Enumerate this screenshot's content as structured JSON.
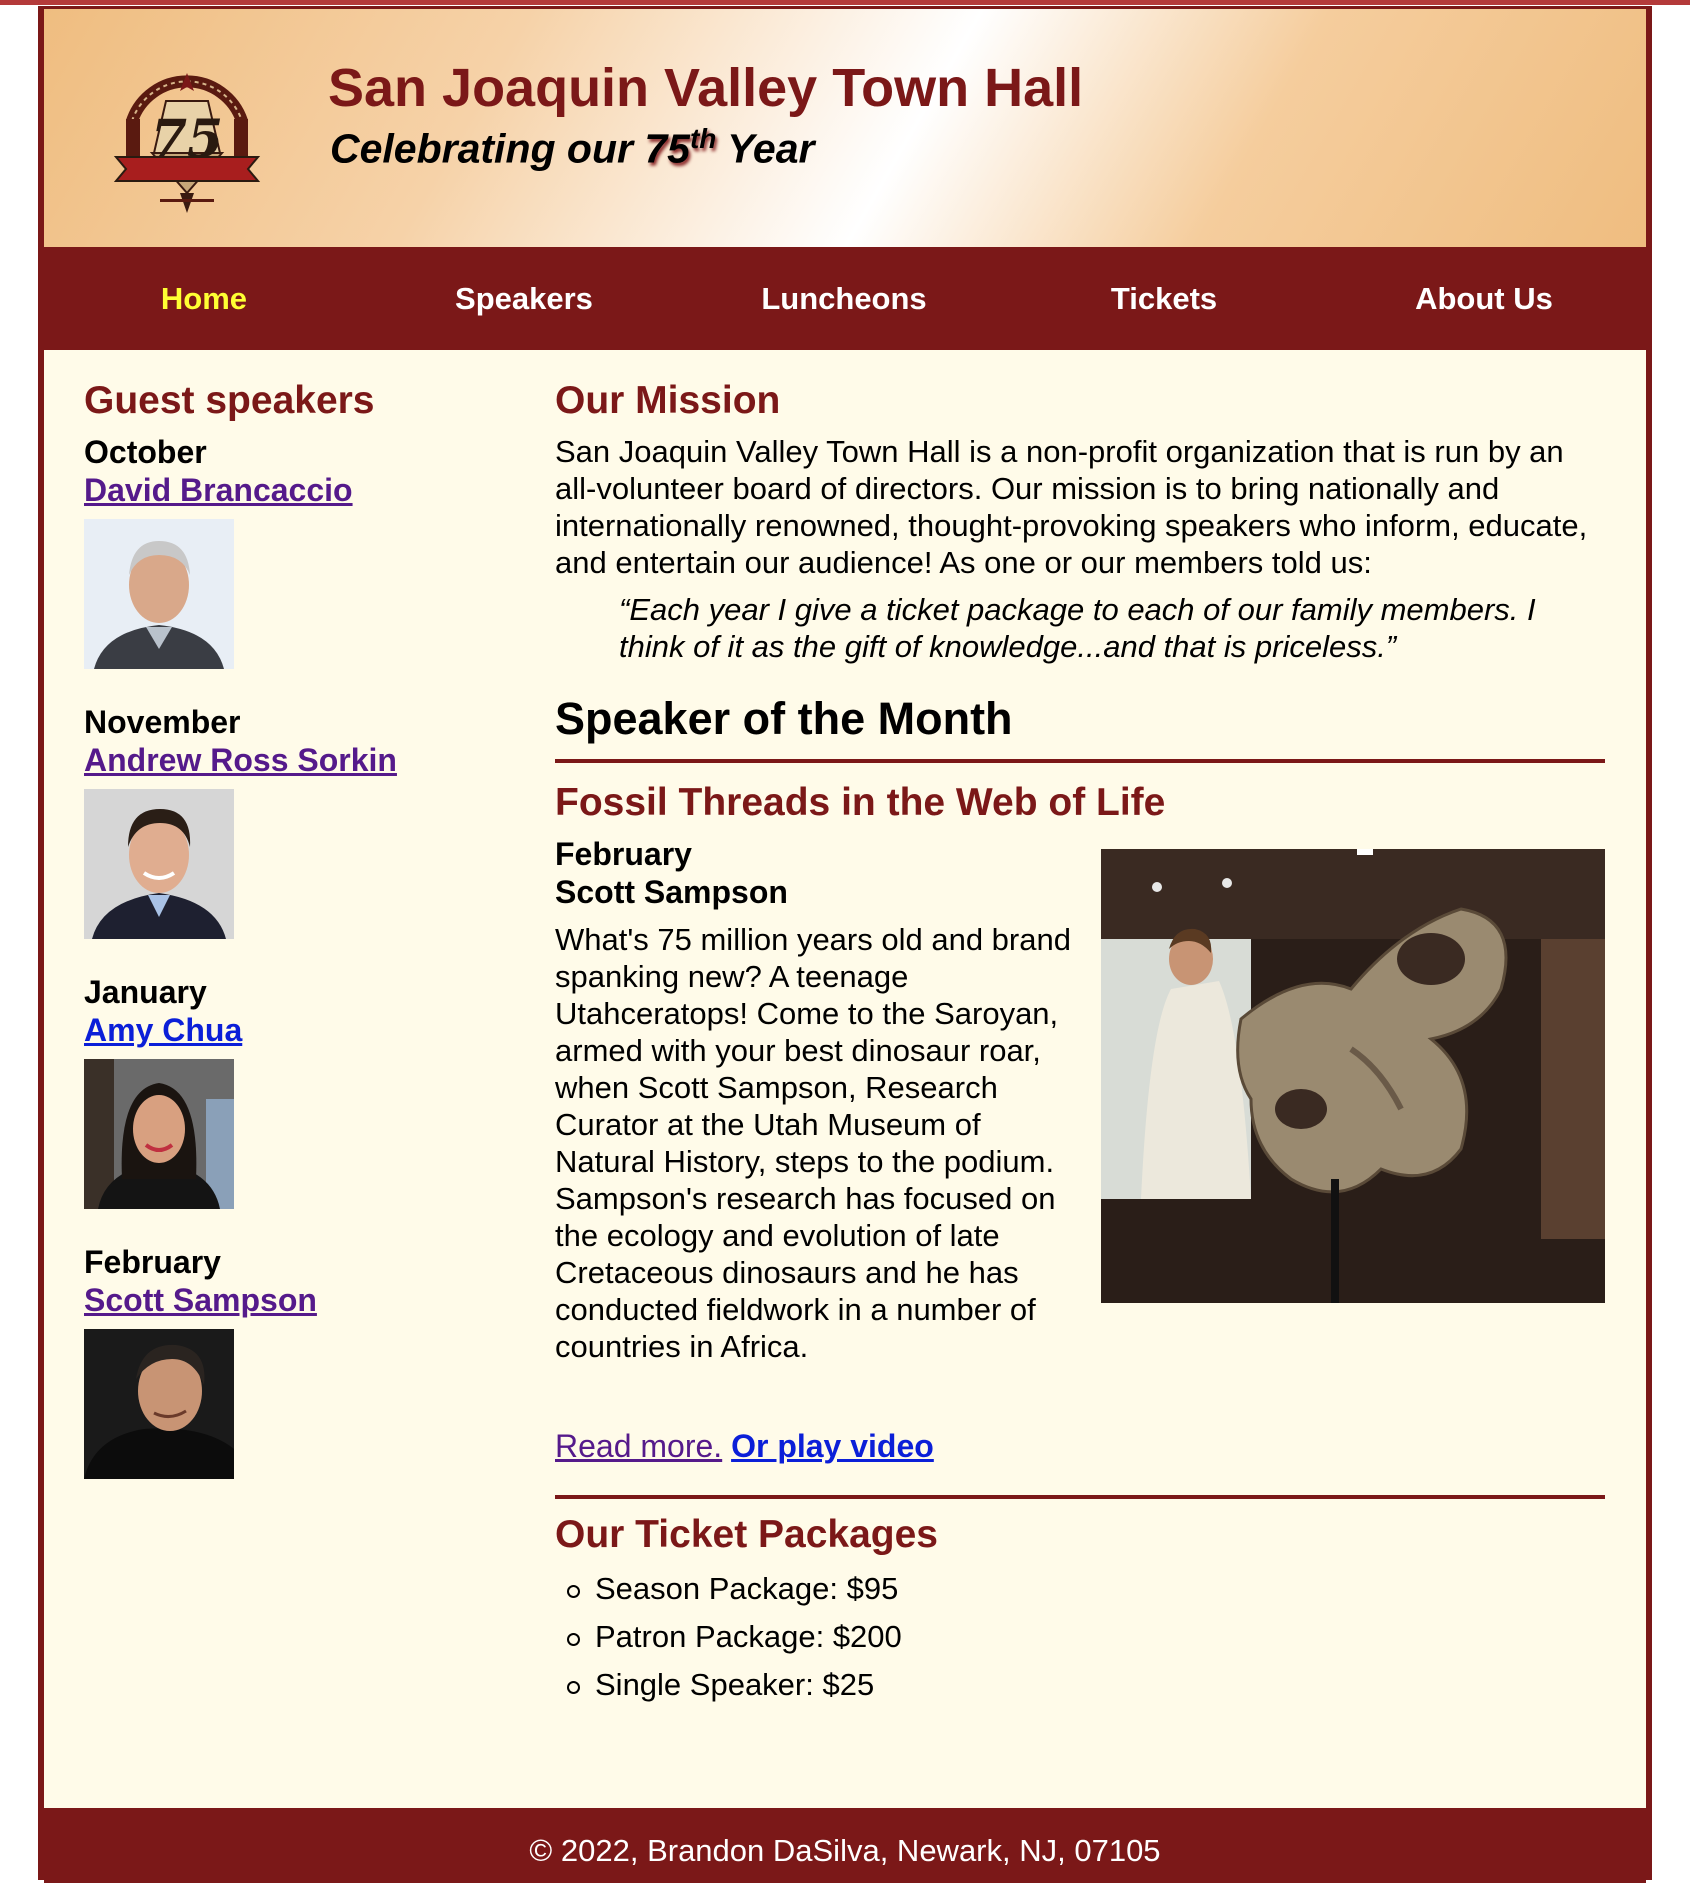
{
  "header": {
    "title": "San Joaquin Valley Town Hall",
    "tagline_prefix": "Celebrating our ",
    "tagline_number": "75",
    "tagline_sup": "th",
    "tagline_suffix": " Year",
    "logo_icon": "town-hall-75th-logo"
  },
  "nav": {
    "items": [
      {
        "label": "Home",
        "current": true
      },
      {
        "label": "Speakers"
      },
      {
        "label": "Luncheons"
      },
      {
        "label": "Tickets"
      },
      {
        "label": "About Us"
      }
    ]
  },
  "sidebar": {
    "heading": "Guest speakers",
    "speakers": [
      {
        "month": "October",
        "name": "David Brancaccio"
      },
      {
        "month": "November",
        "name": "Andrew Ross Sorkin"
      },
      {
        "month": "January",
        "name": "Amy Chua"
      },
      {
        "month": "February",
        "name": "Scott Sampson"
      }
    ]
  },
  "main": {
    "mission_heading": "Our Mission",
    "mission_text": "San Joaquin Valley Town Hall is a non-profit organization that is run by an all-volunteer board of directors. Our mission is to bring nationally and internationally renowned, thought-provoking speakers who inform, educate, and entertain our audience! As one or our members told us:",
    "quote": "“Each year I give a ticket package to each of our family members. I think of it as the gift of knowledge...and that is priceless.”",
    "som_heading": "Speaker of the Month",
    "talk_title": "Fossil Threads in the Web of Life",
    "feature_month": "February",
    "feature_name": "Scott Sampson",
    "feature_desc": "What's 75 million years old and brand spanking new? A teenage Utahceratops! Come to the Saroyan, armed with your best dinosaur roar, when Scott Sampson, Research Curator at the Utah Museum of Natural History, steps to the podium. Sampson's research has focused on the ecology and evolution of late Cretaceous dinosaurs and he has conducted fieldwork in a number of countries in Africa.",
    "read_more": "Read more.",
    "play_video": "Or play video",
    "tickets_heading": "Our Ticket Packages",
    "packages": [
      "Season Package: $95",
      "Patron Package: $200",
      "Single Speaker: $25"
    ]
  },
  "footer": {
    "text": "© 2022, Brandon DaSilva, Newark, NJ, 07105"
  },
  "colors": {
    "brand": "#7b1818",
    "nav_current": "#ffff33",
    "background": "#fffbe9",
    "visited_link": "#551a8b",
    "link": "#0b1fd8"
  }
}
